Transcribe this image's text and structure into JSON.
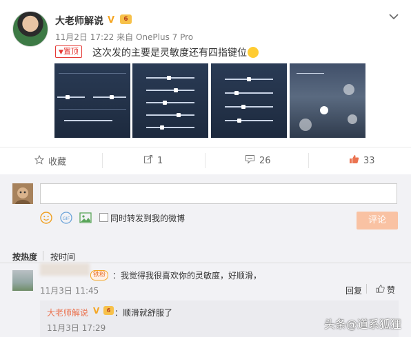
{
  "post": {
    "author": "大老师解说",
    "verified_mark": "V",
    "level_badge": "6",
    "date": "11月2日 17:22",
    "source_prefix": "来自",
    "source": "OnePlus 7 Pro",
    "pin_label": "置顶",
    "text": "这次发的主要是灵敏度还有四指键位"
  },
  "actions": {
    "favorite": "收藏",
    "repost_count": "1",
    "comment_count": "26",
    "like_count": "33"
  },
  "compose": {
    "placeholder": "",
    "also_repost": "同时转发到我的微博",
    "submit": "评论"
  },
  "sort": {
    "by_hot": "按热度",
    "by_time": "按时间"
  },
  "comments": [
    {
      "fan_badge": "铁粉",
      "text": "我觉得我很喜欢你的灵敏度，好顺滑，",
      "time": "11月3日 11:45",
      "reply_label": "回复",
      "like_label": "赞",
      "reply": {
        "author": "大老师解说",
        "text": "顺滑就舒服了",
        "time": "11月3日 17:29"
      }
    }
  ],
  "watermark": "头条@道系狐狸",
  "colors": {
    "accent": "#eb7350",
    "link": "#eb7350",
    "submit_disabled": "#f9c2a3"
  }
}
